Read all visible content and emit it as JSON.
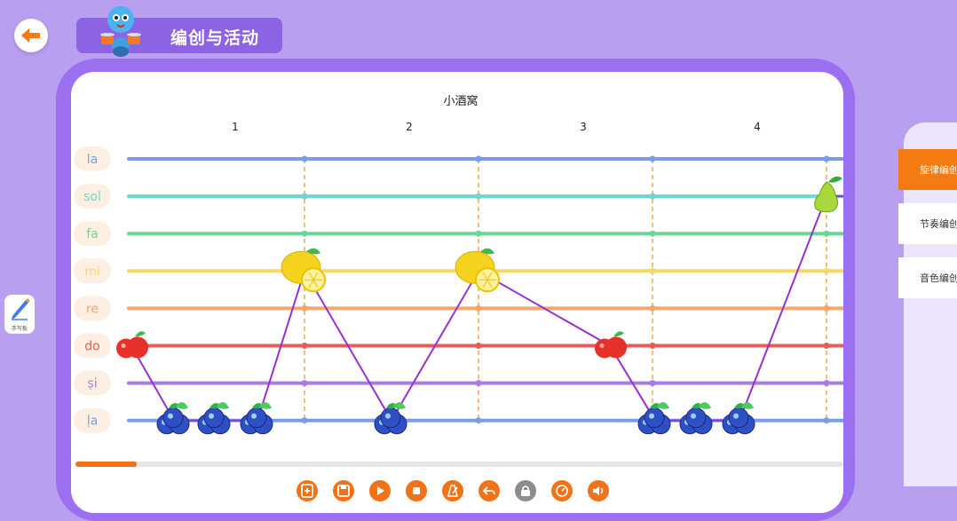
{
  "header": {
    "title": "编创与活动"
  },
  "song": {
    "title": "小酒窝"
  },
  "measures": [
    "1",
    "2",
    "3",
    "4"
  ],
  "pitches": [
    {
      "label": "la",
      "color": "#7b9ce8"
    },
    {
      "label": "sol",
      "color": "#6fd6d0"
    },
    {
      "label": "fa",
      "color": "#69d694"
    },
    {
      "label": "mi",
      "color": "#f6d86a"
    },
    {
      "label": "re",
      "color": "#f4a66c"
    },
    {
      "label": "do",
      "color": "#ea5a56"
    },
    {
      "label": "ṣi",
      "color": "#a67de3"
    },
    {
      "label": "ḷa",
      "color": "#7b9ce8"
    }
  ],
  "notes": [
    {
      "fruit": "apple",
      "pitch": "do"
    },
    {
      "fruit": "blueberry",
      "pitch": "ḷa"
    },
    {
      "fruit": "blueberry",
      "pitch": "ḷa"
    },
    {
      "fruit": "blueberry",
      "pitch": "ḷa"
    },
    {
      "fruit": "lemon",
      "pitch": "mi"
    },
    {
      "fruit": "blueberry",
      "pitch": "ḷa"
    },
    {
      "fruit": "lemon",
      "pitch": "mi"
    },
    {
      "fruit": "apple",
      "pitch": "do"
    },
    {
      "fruit": "blueberry",
      "pitch": "ḷa"
    },
    {
      "fruit": "blueberry",
      "pitch": "ḷa"
    },
    {
      "fruit": "blueberry",
      "pitch": "ḷa"
    },
    {
      "fruit": "pear",
      "pitch": "sol"
    }
  ],
  "playback": {
    "progress_fraction": 0.08
  },
  "side_tool": {
    "label": "手写板"
  },
  "modes": [
    {
      "label": "旋律编创",
      "active": true
    },
    {
      "label": "节奏编创",
      "active": false
    },
    {
      "label": "音色编创",
      "active": false
    }
  ],
  "toolbar": [
    {
      "icon": "add-file-icon",
      "color": "#f0731a"
    },
    {
      "icon": "save-icon",
      "color": "#f0731a"
    },
    {
      "icon": "play-icon",
      "color": "#f0731a"
    },
    {
      "icon": "stop-icon",
      "color": "#f0731a"
    },
    {
      "icon": "metronome-icon",
      "color": "#f0731a"
    },
    {
      "icon": "undo-icon",
      "color": "#f0731a"
    },
    {
      "icon": "lock-icon",
      "color": "#8d8d8d"
    },
    {
      "icon": "tempo-icon",
      "color": "#f0731a"
    },
    {
      "icon": "volume-icon",
      "color": "#f0731a"
    }
  ],
  "colors": {
    "background": "#b89ff0",
    "frame": "#9c6ef0",
    "accent": "#f0731a",
    "connector": "#9a2fd1"
  }
}
